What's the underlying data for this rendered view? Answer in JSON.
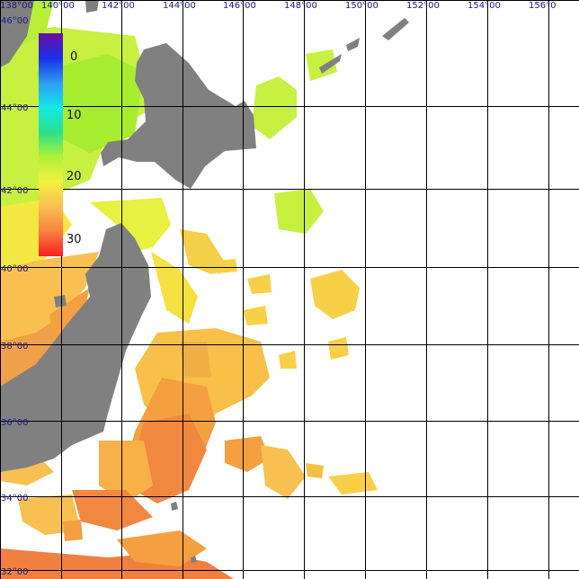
{
  "map": {
    "graticule": {
      "lon_labels": [
        "138°00",
        "140°00",
        "142°00",
        "144°00",
        "146°00",
        "148°00",
        "150°00",
        "152°00",
        "154°00",
        "156°0"
      ],
      "lat_labels": [
        "46°00",
        "44°00",
        "42°00",
        "40°00",
        "38°00",
        "36°00",
        "34°00",
        "32°00"
      ]
    },
    "colorbar": {
      "ticks": [
        "0",
        "10",
        "20",
        "30"
      ],
      "stops": [
        "#6a0fa0",
        "#1a2fe8",
        "#2d9df0",
        "#14e8e8",
        "#28e08c",
        "#b0f038",
        "#f4f040",
        "#f8c050",
        "#f88040",
        "#f82020"
      ]
    },
    "colors": {
      "land": "#808080",
      "grid": "#000000",
      "label": "#1a1a80"
    }
  }
}
